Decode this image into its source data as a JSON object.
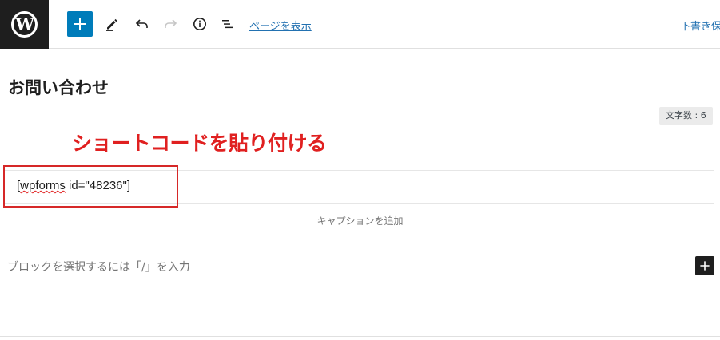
{
  "toolbar": {
    "logo_text": "W",
    "preview_label": "ページを表示",
    "draft_label": "下書き保"
  },
  "icons": {
    "add": "plus-icon",
    "edit": "pencil-icon",
    "undo": "undo-icon",
    "redo": "redo-icon",
    "info": "info-icon",
    "list": "list-view-icon",
    "inserter": "plus-icon"
  },
  "editor": {
    "title": "お問い合わせ",
    "word_count": "文字数 : 6",
    "annotation": "ショートコードを貼り付ける",
    "shortcode_prefix": "[",
    "shortcode_word": "wpforms",
    "shortcode_rest": " id=\"48236\"]",
    "caption_placeholder": "キャプションを追加",
    "block_placeholder": "ブロックを選択するには「/」を入力"
  },
  "colors": {
    "accent": "#007cba",
    "link": "#2271b1",
    "annotation": "#e02020"
  }
}
